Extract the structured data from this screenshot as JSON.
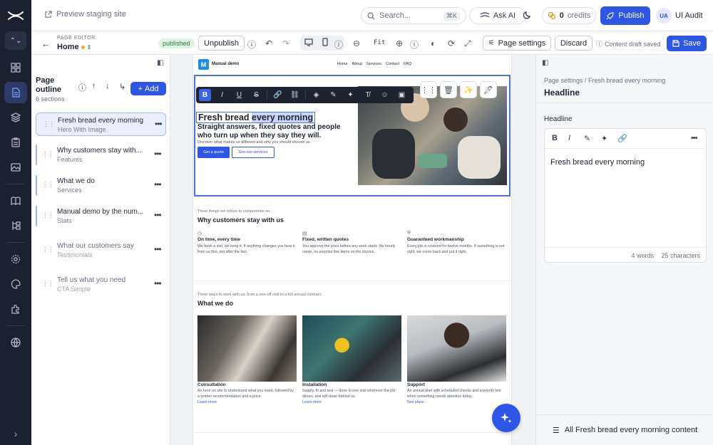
{
  "topbar": {
    "preview_label": "Preview staging site",
    "search_placeholder": "Search...",
    "search_shortcut": "⌘K",
    "ask_ai_label": "Ask AI",
    "credits_count": "0",
    "credits_label": "credits",
    "publish_label": "Publish",
    "user_initials": "UA",
    "user_name": "UI Audit"
  },
  "editor_bar": {
    "label": "PAGE EDITOR",
    "page_name": "Home",
    "status_badge": "published",
    "unpublish_label": "Unpublish",
    "zoom_label": "Fit",
    "page_settings_label": "Page settings",
    "discard_label": "Discard",
    "draft_status": "Content draft saved",
    "save_label": "Save"
  },
  "outline": {
    "title": "Page outline",
    "count": "6 sections",
    "add_label": "Add",
    "items": [
      {
        "title": "Fresh bread every morning",
        "type": "Hero With Image"
      },
      {
        "title": "Why customers stay with...",
        "type": "Features"
      },
      {
        "title": "What we do",
        "type": "Services"
      },
      {
        "title": "Manual demo by the num...",
        "type": "Stats"
      },
      {
        "title": "What our customers say",
        "type": "Testimonials"
      },
      {
        "title": "Tell us what you need",
        "type": "CTA Simple"
      }
    ]
  },
  "site": {
    "name": "Manual demo",
    "logo_letter": "M",
    "nav": [
      "Home",
      "About",
      "Services",
      "Contact",
      "FAQ"
    ],
    "hero": {
      "headline_a": "Fresh bread ",
      "headline_b": "every morning",
      "subheadline": "Straight answers, fixed quotes and people who turn up when they say they will.",
      "description": "Discover what makes us different and why you should choose us.",
      "cta_primary": "Get a quote",
      "cta_secondary": "See our services"
    },
    "features": {
      "eyebrow": "Three things we refuse to compromise on.",
      "title": "Why customers stay with us",
      "items": [
        {
          "title": "On time, every time",
          "desc": "We book a slot, we keep it. If anything changes you hear it from us first, not after the fact."
        },
        {
          "title": "Fixed, written quotes",
          "desc": "You approve the price before any work starts. No hourly creep, no surprise line items on the invoice."
        },
        {
          "title": "Guaranteed workmanship",
          "desc": "Every job is covered for twelve months. If something is not right, we come back and put it right."
        }
      ]
    },
    "services": {
      "eyebrow": "Three ways to work with us, from a one-off visit to a full annual contract.",
      "title": "What we do",
      "items": [
        {
          "title": "Consultation",
          "desc": "An hour on site to understand what you need, followed by a written recommendation and a price.",
          "link": "Learn more"
        },
        {
          "title": "Installation",
          "desc": "Supply, fit and test — done in one visit wherever the job allows, and left clean behind us.",
          "link": "Learn more"
        },
        {
          "title": "Support",
          "desc": "An annual plan with scheduled checks and a priority line when something needs attention today.",
          "link": "See plans"
        }
      ]
    }
  },
  "right_panel": {
    "breadcrumb": "Page settings / Fresh bread every morning",
    "title": "Headline",
    "field_label": "Headline",
    "value": "Fresh bread every morning",
    "word_count": "4 words",
    "char_count": "25 characters",
    "bottom_link": "All Fresh bread every morning content"
  },
  "colors": {
    "accent": "#2d55e6",
    "rail": "#1c2130",
    "published_badge": "#dff5e3"
  }
}
